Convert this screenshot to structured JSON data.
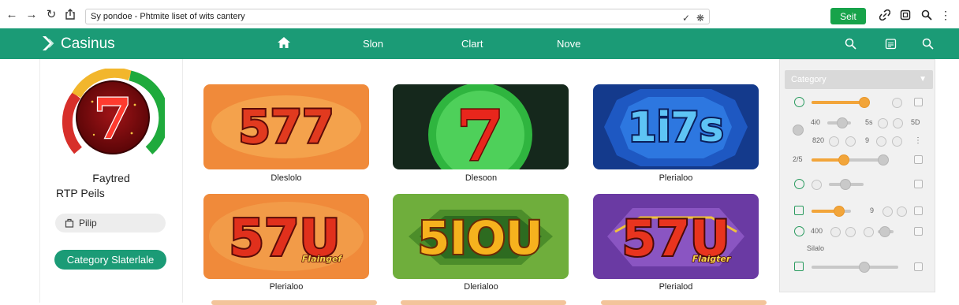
{
  "browser": {
    "url_text": "Sy pondoe - Phtmite liset of wits cantery",
    "set_label": "Seit"
  },
  "nav": {
    "brand": "Casinus",
    "links": [
      "Slon",
      "Clart",
      "Nove"
    ]
  },
  "left": {
    "gauge_number": "7",
    "title": "Faytred",
    "subtitle": "RTP Peils",
    "pill_label": "Pilip",
    "category_button": "Category Slaterlale"
  },
  "games": [
    {
      "art": "577",
      "caption": "Dleslolo"
    },
    {
      "art": "7",
      "caption": "Dlesoon"
    },
    {
      "art": "1i7s",
      "caption": "Plerialoo"
    },
    {
      "art": "57U",
      "tag": "Flaingef",
      "caption": "Plerialoo"
    },
    {
      "art": "5IOU",
      "caption": "Dlerialoo"
    },
    {
      "art": "57U",
      "tag": "Flaigter",
      "caption": "Plerialod"
    }
  ],
  "filters": {
    "category_label": "Category",
    "row_texts": {
      "r2_left": "4i0",
      "r2_mid": "5s",
      "r2_right": "5D",
      "r3_left": "820",
      "r3_mid": "9",
      "r4_left": "2/5",
      "r6_mid": "9",
      "r7_left": "400",
      "r8_text": "Silalo"
    }
  },
  "colors": {
    "brand_green": "#1b9b76",
    "button_green": "#17a34a",
    "slider_accent": "#f2a53a"
  }
}
